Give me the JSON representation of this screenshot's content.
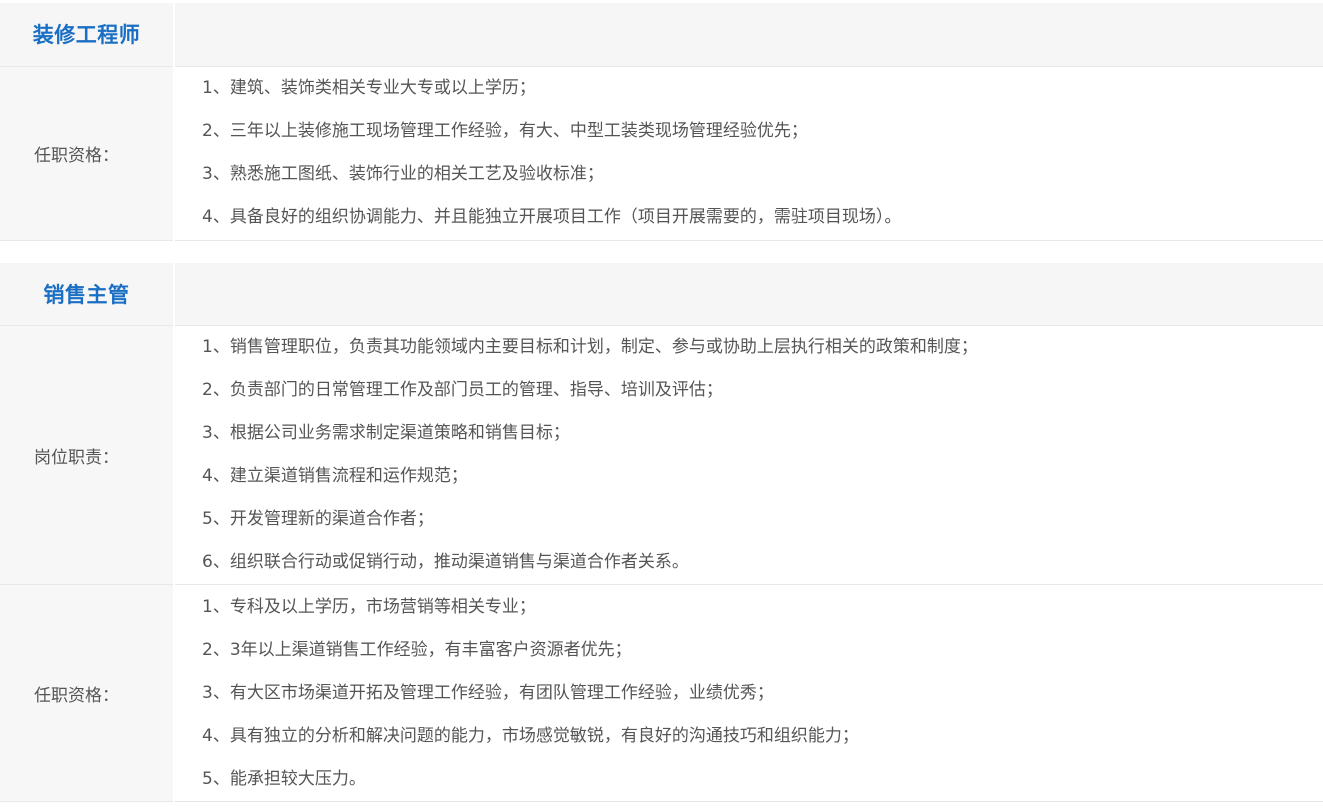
{
  "jobs": [
    {
      "title": "装修工程师",
      "sections": [
        {
          "label": "任职资格：",
          "items": [
            "1、建筑、装饰类相关专业大专或以上学历；",
            "2、三年以上装修施工现场管理工作经验，有大、中型工装类现场管理经验优先；",
            "3、熟悉施工图纸、装饰行业的相关工艺及验收标准；",
            "4、具备良好的组织协调能力、并且能独立开展项目工作（项目开展需要的，需驻项目现场）。"
          ]
        }
      ]
    },
    {
      "title": "销售主管",
      "sections": [
        {
          "label": "岗位职责：",
          "items": [
            "1、销售管理职位，负责其功能领域内主要目标和计划，制定、参与或协助上层执行相关的政策和制度；",
            "2、负责部门的日常管理工作及部门员工的管理、指导、培训及评估；",
            "3、根据公司业务需求制定渠道策略和销售目标；",
            "4、建立渠道销售流程和运作规范；",
            "5、开发管理新的渠道合作者；",
            "6、组织联合行动或促销行动，推动渠道销售与渠道合作者关系。"
          ]
        },
        {
          "label": "任职资格：",
          "items": [
            "1、专科及以上学历，市场营销等相关专业；",
            "2、3年以上渠道销售工作经验，有丰富客户资源者优先；",
            "3、有大区市场渠道开拓及管理工作经验，有团队管理工作经验，业绩优秀；",
            "4、具有独立的分析和解决问题的能力，市场感觉敏锐，有良好的沟通技巧和组织能力；",
            "5、能承担较大压力。"
          ]
        }
      ]
    }
  ],
  "colors": {
    "title": "#1a6fc4",
    "text": "#555555",
    "label_bg": "#f7f7f7",
    "border": "#e8e8e8"
  }
}
